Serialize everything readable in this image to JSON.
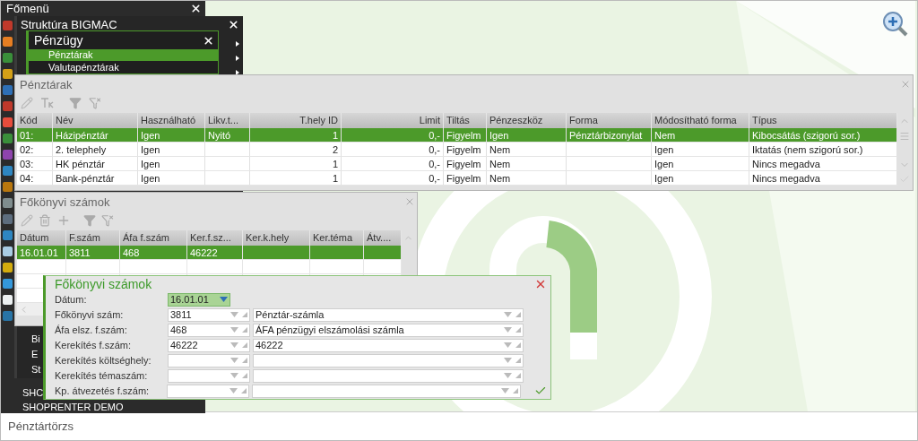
{
  "main_menu": {
    "title": "Főmenü",
    "items": [
      "SHC",
      "SHOPRENTER DEMO"
    ]
  },
  "structure_window": {
    "title": "Struktúra BIGMAC",
    "items": [
      "Bi",
      "E",
      "St"
    ]
  },
  "submenu": {
    "title": "Pénzügy",
    "items": [
      {
        "label": "Pénztárak",
        "selected": true
      },
      {
        "label": "Valutapénztárak",
        "selected": false
      }
    ]
  },
  "cash_registers": {
    "title": "Pénztárak",
    "columns": [
      {
        "label": "Kód",
        "right_aligned": false
      },
      {
        "label": "Név",
        "right_aligned": false
      },
      {
        "label": "Használható",
        "right_aligned": false
      },
      {
        "label": "Likv.t...",
        "right_aligned": false
      },
      {
        "label": "T.hely ID",
        "right_aligned": true
      },
      {
        "label": "Limit",
        "right_aligned": true
      },
      {
        "label": "Tiltás",
        "right_aligned": false
      },
      {
        "label": "Pénzeszköz",
        "right_aligned": false
      },
      {
        "label": "Forma",
        "right_aligned": false
      },
      {
        "label": "Módosítható forma",
        "right_aligned": false
      },
      {
        "label": "Típus",
        "right_aligned": false
      }
    ],
    "rows": [
      {
        "selected": true,
        "cells": [
          "01:",
          "Házipénztár",
          "Igen",
          "Nyitó",
          "1",
          "0,-",
          "Figyelm",
          "Igen",
          "Pénztárbizonylat",
          "Nem",
          "Kibocsátás (szigorú sor.)"
        ]
      },
      {
        "selected": false,
        "cells": [
          "02:",
          "2. telephely",
          "Igen",
          "",
          "2",
          "0,-",
          "Figyelm",
          "Nem",
          "",
          "Igen",
          "Iktatás (nem szigorú sor.)"
        ]
      },
      {
        "selected": false,
        "cells": [
          "03:",
          "HK pénztár",
          "Igen",
          "",
          "1",
          "0,-",
          "Figyelm",
          "Nem",
          "",
          "Igen",
          "Nincs megadva"
        ]
      },
      {
        "selected": false,
        "cells": [
          "04:",
          "Bank-pénztár",
          "Igen",
          "",
          "1",
          "0,-",
          "Figyelm",
          "Nem",
          "",
          "Igen",
          "Nincs megadva"
        ]
      }
    ]
  },
  "ledger_accounts": {
    "title": "Főkönyvi számok",
    "columns": [
      "Dátum",
      "F.szám",
      "Áfa f.szám",
      "Ker.f.sz...",
      "Ker.k.hely",
      "Ker.téma",
      "Átv...."
    ],
    "rows": [
      {
        "selected": true,
        "cells": [
          "16.01.01",
          "3811",
          "468",
          "46222"
        ]
      }
    ]
  },
  "dialog": {
    "title": "Főkönyvi számok",
    "date_label": "Dátum:",
    "date_value": "16.01.01",
    "fields": [
      {
        "label": "Főkönyvi szám:",
        "code": "3811",
        "name": "Pénztár-számla"
      },
      {
        "label": "Áfa elsz. f.szám:",
        "code": "468",
        "name": "ÁFA pénzügyi elszámolási számla"
      },
      {
        "label": "Kerekítés f.szám:",
        "code": "46222",
        "name": "46222"
      },
      {
        "label": "Kerekítés költséghely:"
      },
      {
        "label": "Kerekítés témaszám:"
      },
      {
        "label": "Kp. átvezetés f.szám:"
      }
    ]
  },
  "status_bar": "Pénztártörzs"
}
